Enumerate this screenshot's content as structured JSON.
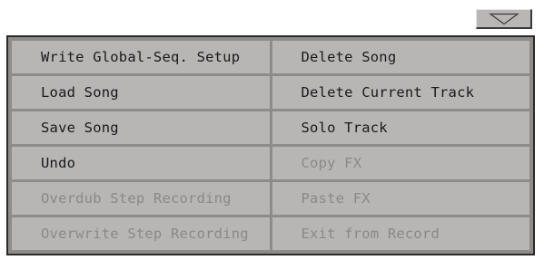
{
  "dropdown": {
    "icon": "triangle-down-icon"
  },
  "menu": {
    "left": [
      {
        "label": "Write Global-Seq. Setup",
        "enabled": true
      },
      {
        "label": "Load Song",
        "enabled": true
      },
      {
        "label": "Save Song",
        "enabled": true
      },
      {
        "label": "Undo",
        "enabled": true
      },
      {
        "label": "Overdub Step Recording",
        "enabled": false
      },
      {
        "label": "Overwrite Step Recording",
        "enabled": false
      }
    ],
    "right": [
      {
        "label": "Delete Song",
        "enabled": true
      },
      {
        "label": "Delete Current Track",
        "enabled": true
      },
      {
        "label": "Solo Track",
        "enabled": true
      },
      {
        "label": "Copy FX",
        "enabled": false
      },
      {
        "label": "Paste FX",
        "enabled": false
      },
      {
        "label": "Exit from Record",
        "enabled": false
      }
    ]
  },
  "colors": {
    "panel_border": "#2a2a2a",
    "panel_bg": "#8e8b8b",
    "item_bg": "#b8b5b5",
    "enabled_text": "#1a1a1a",
    "disabled_text": "#8a8888"
  }
}
